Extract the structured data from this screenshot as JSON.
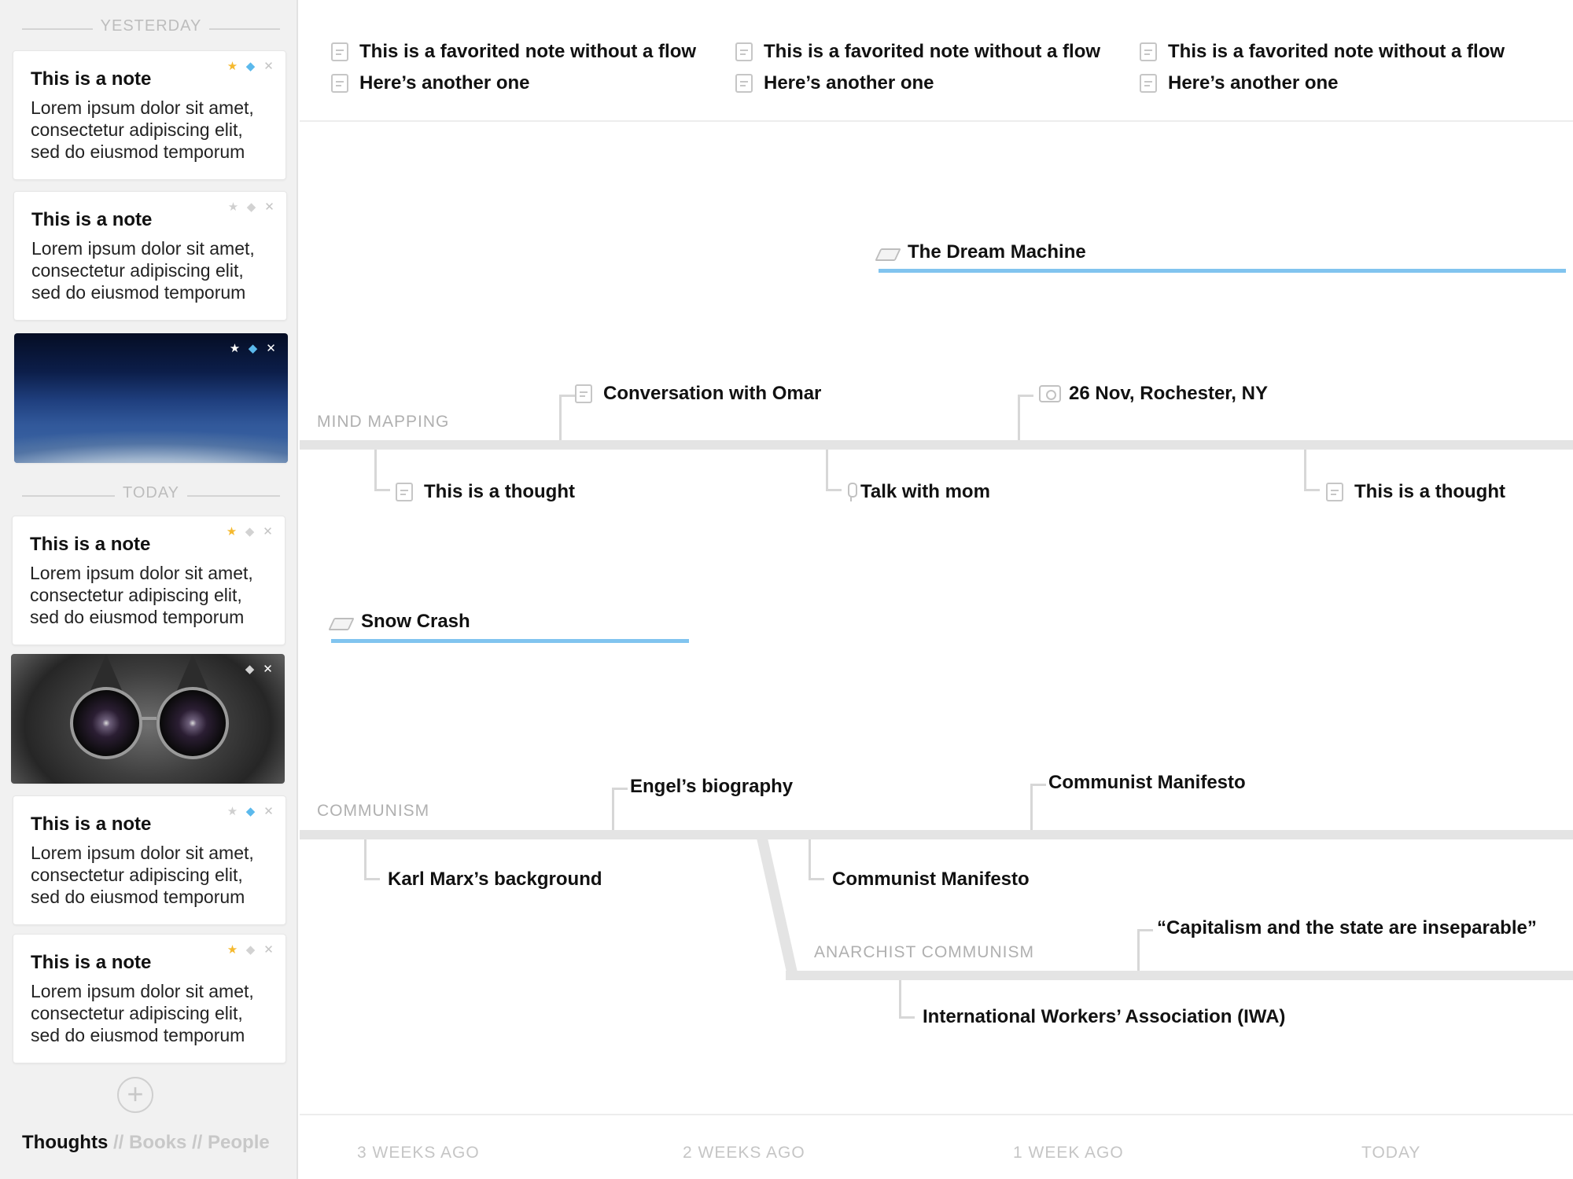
{
  "sidebar": {
    "day_yesterday": "YESTERDAY",
    "day_today": "TODAY",
    "cards": [
      {
        "title": "This is a note",
        "body": "Lorem ipsum dolor sit amet, consectetur adipiscing elit, sed do eiusmod temporum"
      },
      {
        "title": "This is a note",
        "body": "Lorem ipsum dolor sit amet, consectetur adipiscing elit, sed do eiusmod temporum"
      },
      {
        "title": "This is a note",
        "body": "Lorem ipsum dolor sit amet, consectetur adipiscing elit, sed do eiusmod temporum"
      },
      {
        "title": "This is a note",
        "body": "Lorem ipsum dolor sit amet, consectetur adipiscing elit, sed do eiusmod temporum"
      },
      {
        "title": "This is a note",
        "body": "Lorem ipsum dolor sit amet, consectetur adipiscing elit, sed do eiusmod temporum"
      }
    ],
    "actions": {
      "star": "★",
      "tag": "◆",
      "close": "✕"
    },
    "add_symbol": "+",
    "tabs": {
      "thoughts": "Thoughts",
      "books": "// Books",
      "people": "// People"
    }
  },
  "favorites": {
    "columns": [
      {
        "first": "This is a favorited note without a flow",
        "second": "Here’s another one"
      },
      {
        "first": "This is a favorited note without a flow",
        "second": "Here’s another one"
      },
      {
        "first": "This is a favorited note without a flow",
        "second": "Here’s another one"
      }
    ]
  },
  "timeline": {
    "dream_machine": "The Dream Machine",
    "snow_crash": "Snow Crash",
    "mind_mapping": {
      "name": "MIND MAPPING",
      "conversation": "Conversation with Omar",
      "rochester": "26 Nov, Rochester, NY",
      "thought_1": "This is a thought",
      "talk_mom": "Talk with mom",
      "thought_2": "This is a thought"
    },
    "communism": {
      "name": "COMMUNISM",
      "engel": "Engel’s biography",
      "manifesto_top": "Communist Manifesto",
      "marx": "Karl Marx’s background",
      "manifesto_bottom": "Communist Manifesto"
    },
    "anarchist": {
      "name": "ANARCHIST COMMUNISM",
      "quote": "“Capitalism and the state are inseparable”",
      "iwa": "International Workers’ Association (IWA)"
    }
  },
  "axis": {
    "labels": [
      "3 WEEKS AGO",
      "2 WEEKS AGO",
      "1 WEEK AGO",
      "TODAY"
    ]
  },
  "colors": {
    "accent_blue": "#81c4ef",
    "star_yellow": "#f5b92e",
    "tag_blue": "#5bb9ec"
  }
}
